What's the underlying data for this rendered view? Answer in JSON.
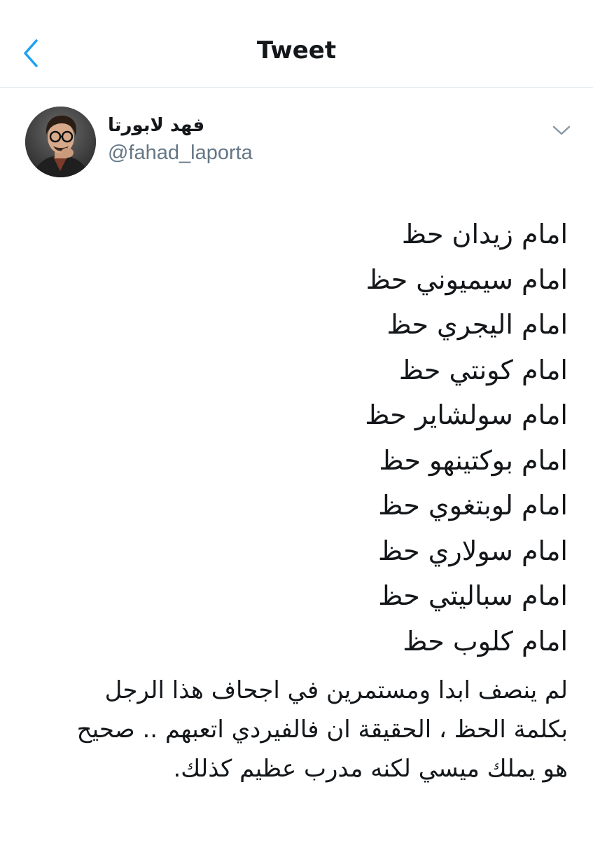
{
  "nav": {
    "title": "Tweet",
    "back_icon": "chevron-left-icon",
    "accent": "#1da1f2"
  },
  "tweet": {
    "author": {
      "display_name": "فهد لابورتا",
      "handle": "@fahad_laporta"
    },
    "more_icon": "chevron-down-icon",
    "lines": [
      "امام زيدان حظ",
      "امام سيميوني حظ",
      "امام اليجري حظ",
      "امام كونتي حظ",
      "امام سولشاير حظ",
      "امام بوكتينهو حظ",
      "امام لوبتغوي حظ",
      "امام سولاري حظ",
      "امام سباليتي حظ",
      "امام كلوب حظ"
    ],
    "paragraph": [
      "لم ينصف ابدا ومستمرين في اجحاف هذا الرجل",
      "بكلمة الحظ ، الحقيقة ان فالفيردي اتعبهم .. صحيح",
      "هو يملك ميسي لكنه مدرب عظيم كذلك."
    ]
  }
}
